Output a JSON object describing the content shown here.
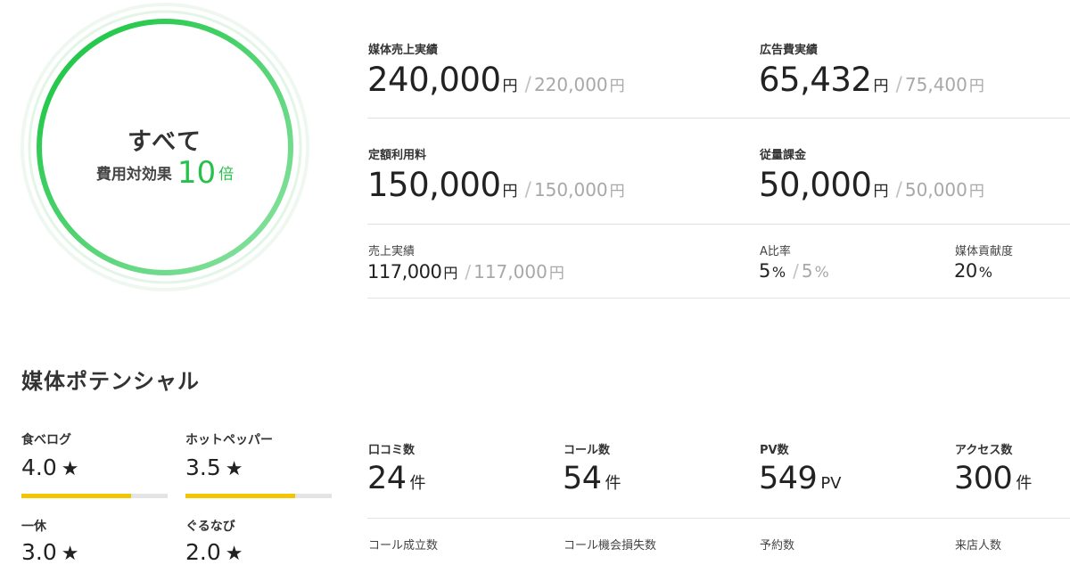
{
  "summary": {
    "title": "すべて",
    "effect_label": "費用対効果",
    "effect_value": "10",
    "effect_unit": "倍"
  },
  "metrics": {
    "media_sales": {
      "label": "媒体売上実績",
      "value": "240,000",
      "unit": "円",
      "target": "220,000",
      "target_unit": "円"
    },
    "ad_cost": {
      "label": "広告費実績",
      "value": "65,432",
      "unit": "円",
      "target": "75,400",
      "target_unit": "円"
    },
    "flat_fee": {
      "label": "定額利用料",
      "value": "150,000",
      "unit": "円",
      "target": "150,000",
      "target_unit": "円"
    },
    "usage_fee": {
      "label": "従量課金",
      "value": "50,000",
      "unit": "円",
      "target": "50,000",
      "target_unit": "円"
    },
    "sales": {
      "label": "売上実績",
      "value": "117,000",
      "unit": "円",
      "target": "117,000",
      "target_unit": "円"
    },
    "a_ratio": {
      "label": "A比率",
      "value": "5",
      "unit": "%",
      "target": "5",
      "target_unit": "%"
    },
    "contribution": {
      "label": "媒体貢献度",
      "value": "20",
      "unit": "%"
    }
  },
  "potential": {
    "title": "媒体ポテンシャル",
    "ratings": [
      {
        "name": "食べログ",
        "value": "4.0",
        "fill": 0.75
      },
      {
        "name": "ホットペッパー",
        "value": "3.5",
        "fill": 0.75
      },
      {
        "name": "一休",
        "value": "3.0"
      },
      {
        "name": "ぐるなび",
        "value": "2.0"
      }
    ],
    "star": "★",
    "counts": [
      {
        "label": "口コミ数",
        "value": "24",
        "unit": "件"
      },
      {
        "label": "コール数",
        "value": "54",
        "unit": "件"
      },
      {
        "label": "PV数",
        "value": "549",
        "unit": "PV"
      },
      {
        "label": "アクセス数",
        "value": "300",
        "unit": "件"
      }
    ],
    "more_counts": [
      {
        "label": "コール成立数"
      },
      {
        "label": "コール機会損失数"
      },
      {
        "label": "予約数"
      },
      {
        "label": "来店人数"
      }
    ]
  },
  "colors": {
    "ring_start": "#12c43c",
    "ring_end": "#8fe3a6",
    "accent": "#25c14a",
    "bar": "#f2c500"
  }
}
